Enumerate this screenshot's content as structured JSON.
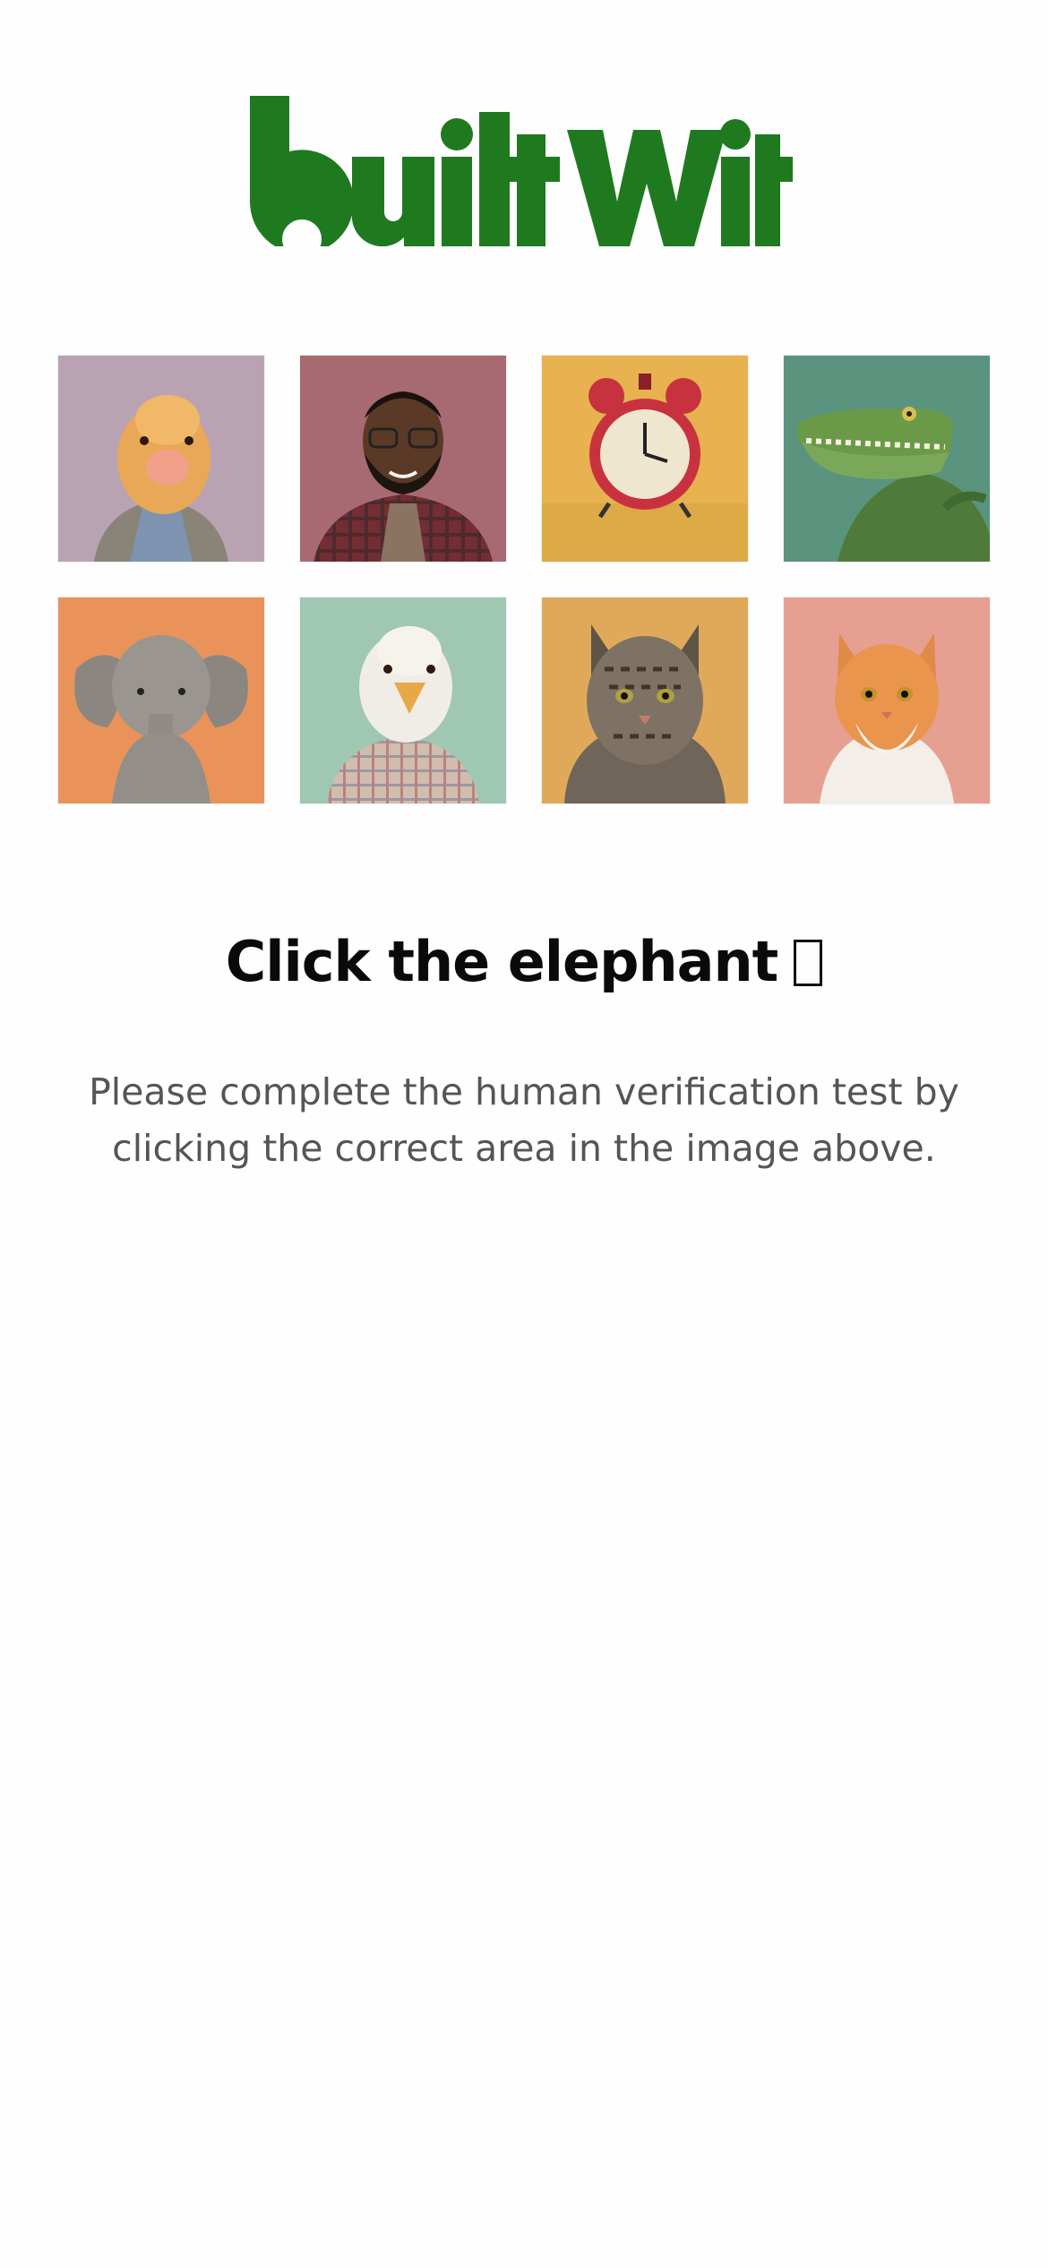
{
  "logo": {
    "text": "built With",
    "color": "#1f7a1f"
  },
  "captcha": {
    "tiles": [
      {
        "label": "duck",
        "icon": "duck-portrait",
        "bg": "#b9a3b2"
      },
      {
        "label": "man",
        "icon": "man-portrait",
        "bg": "#a86a72"
      },
      {
        "label": "alarm clock",
        "icon": "alarm-clock",
        "bg": "#e7b24f"
      },
      {
        "label": "crocodile",
        "icon": "crocodile-portrait",
        "bg": "#5a937e"
      },
      {
        "label": "elephant",
        "icon": "elephant-portrait",
        "bg": "#e9935a"
      },
      {
        "label": "white bird",
        "icon": "bird-portrait",
        "bg": "#9fc7b2"
      },
      {
        "label": "tabby cat",
        "icon": "tabby-cat-portrait",
        "bg": "#e0a95a"
      },
      {
        "label": "ginger cat",
        "icon": "ginger-cat-portrait",
        "bg": "#e6a091"
      }
    ],
    "prompt": "Click the elephant",
    "prompt_glyph": "missing-glyph-box",
    "description": "Please complete the human verification test by clicking the correct area in the image above."
  }
}
